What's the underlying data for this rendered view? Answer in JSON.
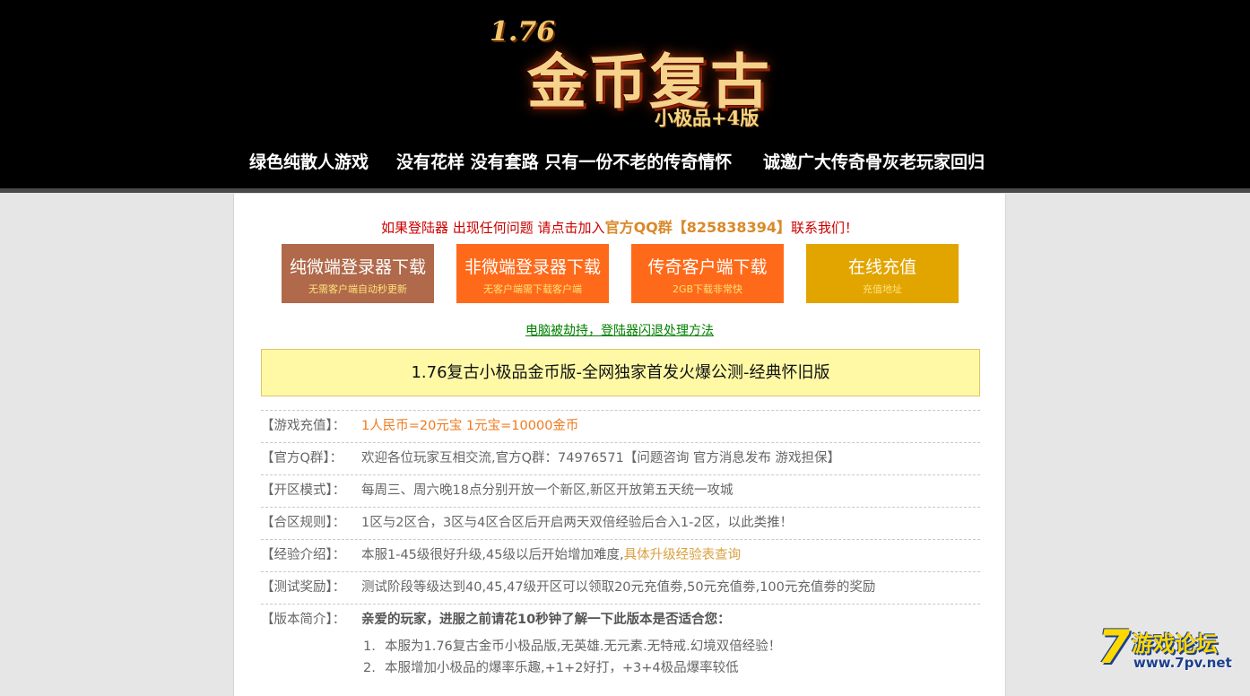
{
  "header": {
    "logo_version": "1.76",
    "logo_main": "金币复古",
    "logo_sub": "小极品+4版",
    "slogans": [
      "绿色纯散人游戏",
      "没有花样 没有套路 只有一份不老的传奇情怀",
      "诚邀广大传奇骨灰老玩家回归"
    ]
  },
  "notice": {
    "prefix": "如果登陆器 出现任何问题 请点击加入",
    "qq_group": "官方QQ群【825838394】",
    "suffix": "联系我们！"
  },
  "buttons": [
    {
      "title": "纯微端登录器下载",
      "sub": "无需客户端自动秒更新",
      "color": "#b0694a"
    },
    {
      "title": "非微端登录器下载",
      "sub": "无客户端需下载客户端",
      "color": "#ff6a1a"
    },
    {
      "title": "传奇客户端下载",
      "sub": "2GB下载非常快",
      "color": "#ff6a1a"
    },
    {
      "title": "在线充值",
      "sub": "充值地址",
      "color": "#e2a500"
    }
  ],
  "fix_link": "电脑被劫持，登陆器闪退处理方法",
  "banner": "1.76复古小极品金币版-全网独家首发火爆公测-经典怀旧版",
  "info": [
    {
      "label": "【游戏充值】：",
      "value": "1人民币=20元宝 1元宝=10000金币"
    },
    {
      "label": "【官方Q群】：",
      "value": "欢迎各位玩家互相交流,官方Q群：74976571【问题咨询 官方消息发布 游戏担保】"
    },
    {
      "label": "【开区模式】：",
      "value": "每周三、周六晚18点分别开放一个新区,新区开放第五天统一攻城"
    },
    {
      "label": "【合区规则】：",
      "value": "1区与2区合，3区与4区合区后开启两天双倍经验后合入1-2区，以此类推！"
    },
    {
      "label": "【经验介绍】：",
      "value": "本服1-45级很好升级,45级以后开始增加难度,",
      "link": "具体升级经验表查询"
    },
    {
      "label": "【测试奖励】：",
      "value": "测试阶段等级达到40,45,47级开区可以领取20元充值劵,50元充值劵,100元充值劵的奖励"
    },
    {
      "label": "【版本简介】：",
      "value": "亲爱的玩家，进服之前请花10秒钟了解一下此版本是否适合您："
    }
  ],
  "intro_items": [
    {
      "num": "1.",
      "text": "本服为1.76复古金币小极品版,无英雄.无元素.无特戒.幻境双倍经验！"
    },
    {
      "num": "2.",
      "text": "本服增加小极品的爆率乐趣,+1+2好打，+3+4极品爆率较低"
    }
  ],
  "watermark": {
    "digit": "7",
    "name": "游戏论坛",
    "url": "www.7pv.net"
  }
}
